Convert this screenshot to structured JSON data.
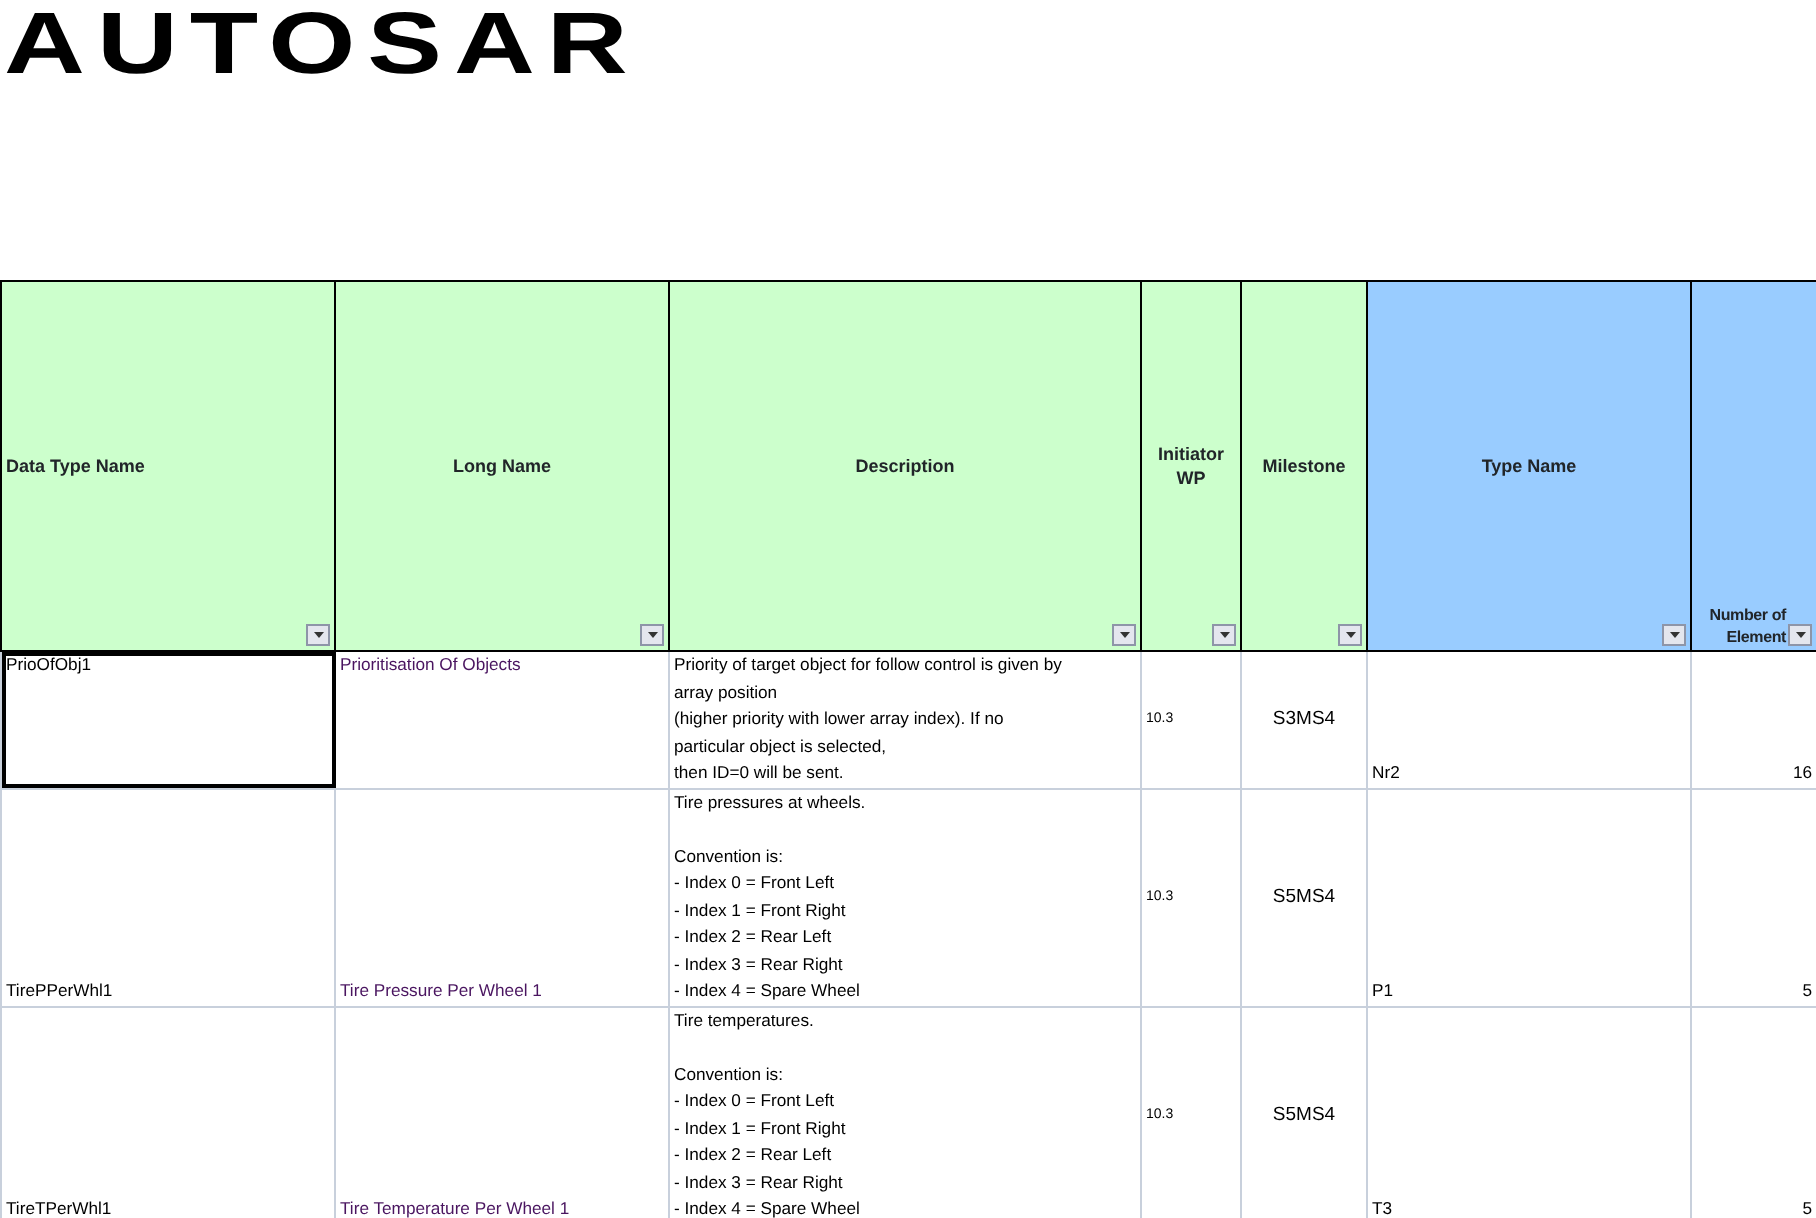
{
  "logo": {
    "text": "AUTOSAR"
  },
  "table": {
    "columns": [
      {
        "label": "Data Type Name",
        "color": "#ccffcc"
      },
      {
        "label": "Long Name",
        "color": "#ccffcc"
      },
      {
        "label": "Description",
        "color": "#ccffcc"
      },
      {
        "label": "Initiator WP",
        "color": "#ccffcc"
      },
      {
        "label": "Milestone",
        "color": "#ccffcc"
      },
      {
        "label": "Type Name",
        "color": "#99ccff"
      },
      {
        "label": "Number of Element",
        "color": "#99ccff"
      }
    ],
    "rows": [
      {
        "data_type_name": "PrioOfObj1",
        "selected": true,
        "long_name": "Prioritisation Of Objects",
        "description": "Priority of target object for follow control is given by\narray position\n(higher priority with lower array index). If no\nparticular object is selected,\nthen ID=0 will be sent.",
        "initiator_wp": "10.3",
        "milestone": "S3MS4",
        "type_name": "Nr2",
        "number_of_element": "16"
      },
      {
        "data_type_name": "TirePPerWhl1",
        "selected": false,
        "long_name": "Tire Pressure Per Wheel 1",
        "description": "Tire pressures at wheels.\n\nConvention is:\n- Index 0 = Front Left\n- Index 1 = Front Right\n- Index 2 = Rear Left\n- Index 3 = Rear Right\n- Index 4 = Spare Wheel",
        "initiator_wp": "10.3",
        "milestone": "S5MS4",
        "type_name": "P1",
        "number_of_element": "5"
      },
      {
        "data_type_name": "TireTPerWhl1",
        "selected": false,
        "long_name": "Tire Temperature Per Wheel 1",
        "description": "Tire temperatures.\n\nConvention is:\n- Index 0 = Front Left\n- Index 1 = Front Right\n- Index 2 = Rear Left\n- Index 3 = Rear Right\n- Index 4 = Spare Wheel",
        "initiator_wp": "10.3",
        "milestone": "S5MS4",
        "type_name": "T3",
        "number_of_element": "5"
      }
    ]
  }
}
